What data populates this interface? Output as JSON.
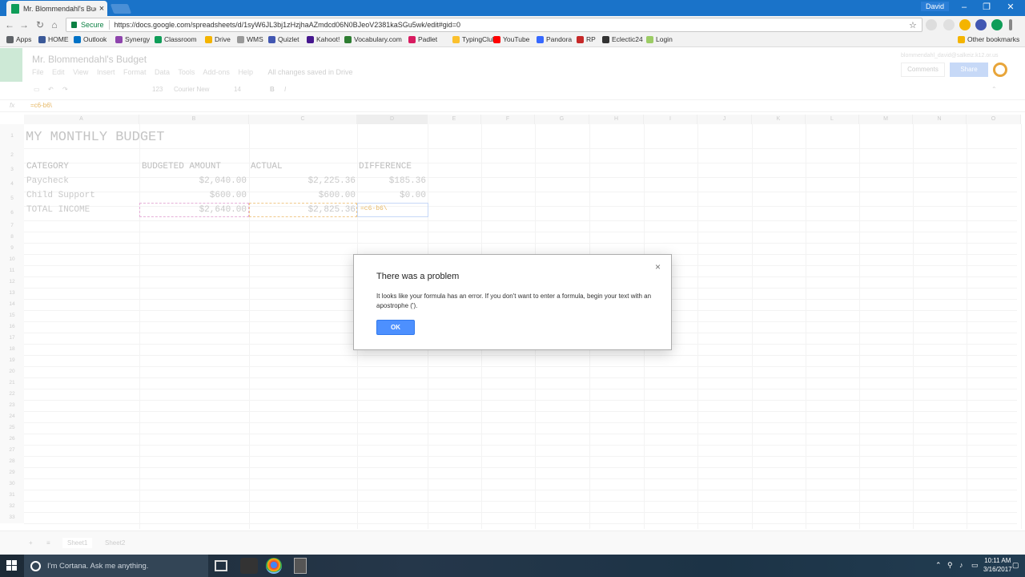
{
  "browser": {
    "tab_title": "Mr. Blommendahl's Budg",
    "tab_close": "×",
    "user": "David",
    "win_min": "–",
    "win_max": "❐",
    "win_close": "✕",
    "nav": {
      "back": "←",
      "forward": "→",
      "reload": "↻",
      "home": "⌂"
    },
    "secure_label": "Secure",
    "url": "https://docs.google.com/spreadsheets/d/1syW6JL3bj1zHzjhaAZmdcd06N0BJeoV2381kaSGu5wk/edit#gid=0",
    "star": "☆"
  },
  "bookmarks": [
    {
      "label": "Apps",
      "color": "#5f6368"
    },
    {
      "label": "HOME",
      "color": "#3b5998"
    },
    {
      "label": "Outlook",
      "color": "#0072c6"
    },
    {
      "label": "Synergy",
      "color": "#8e44ad"
    },
    {
      "label": "Classroom",
      "color": "#0f9d58"
    },
    {
      "label": "Drive",
      "color": "#f4b400"
    },
    {
      "label": "WMS",
      "color": "#999999"
    },
    {
      "label": "Quizlet",
      "color": "#4257b2"
    },
    {
      "label": "Kahoot!",
      "color": "#46178f"
    },
    {
      "label": "Vocabulary.com",
      "color": "#2e7d32"
    },
    {
      "label": "Padlet",
      "color": "#d81b60"
    },
    {
      "label": "TypingClub",
      "color": "#fbc02d"
    },
    {
      "label": "YouTube",
      "color": "#ff0000"
    },
    {
      "label": "Pandora",
      "color": "#3668ff"
    },
    {
      "label": "RP",
      "color": "#c62828"
    },
    {
      "label": "Eclectic24",
      "color": "#333333"
    },
    {
      "label": "Login",
      "color": "#9ccc65"
    },
    {
      "label": "Other bookmarks",
      "color": "#f4b400"
    }
  ],
  "doc": {
    "title": "Mr. Blommendahl's Budget",
    "menus": [
      "File",
      "Edit",
      "View",
      "Insert",
      "Format",
      "Data",
      "Tools",
      "Add-ons",
      "Help"
    ],
    "saved_status": "All changes saved in Drive",
    "account": "blommendahl_david@salkeiz.k12.or.us",
    "comments_label": "Comments",
    "share_label": "Share",
    "font": "Courier New",
    "font_size": "14",
    "zoom_fmt": "123",
    "fx": "fx",
    "formula": "=c6-b6\\"
  },
  "sheet": {
    "columns": [
      "A",
      "B",
      "C",
      "D",
      "E",
      "F",
      "G",
      "H",
      "I",
      "J",
      "K",
      "L",
      "M",
      "N",
      "O"
    ],
    "rows": [
      "1",
      "2",
      "3",
      "4",
      "5",
      "6",
      "7",
      "8",
      "9",
      "10",
      "11",
      "12",
      "13",
      "14",
      "15",
      "16",
      "17",
      "18",
      "19",
      "20",
      "21",
      "22",
      "23",
      "24",
      "25",
      "26",
      "27",
      "28",
      "29",
      "30",
      "31",
      "32",
      "33",
      "34"
    ],
    "title": "MY MONTHLY BUDGET",
    "headers": [
      "CATEGORY",
      "BUDGETED AMOUNT",
      "ACTUAL",
      "DIFFERENCE"
    ],
    "data": [
      [
        "Paycheck",
        "$2,040.00",
        "$2,225.36",
        "$185.36"
      ],
      [
        "Child Support",
        "$600.00",
        "$600.00",
        "$0.00"
      ],
      [
        "TOTAL INCOME",
        "$2,640.00",
        "$2,825.36",
        ""
      ]
    ],
    "active_cell_text": "=c6-b6\\",
    "tabs": [
      "Sheet1",
      "Sheet2"
    ]
  },
  "dialog": {
    "title": "There was a problem",
    "message": "It looks like your formula has an error. If you don't want to enter a formula, begin your text with an apostrophe (').",
    "ok_label": "OK",
    "close": "×"
  },
  "taskbar": {
    "cortana_placeholder": "I'm Cortana. Ask me anything.",
    "time": "10:11 AM",
    "date": "3/16/2017"
  }
}
